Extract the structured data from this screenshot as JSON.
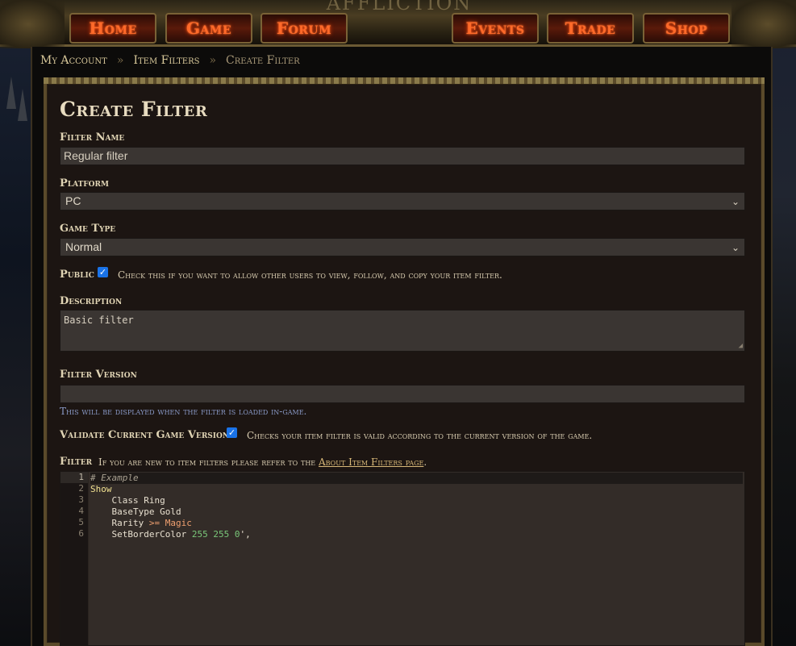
{
  "nav": {
    "logo": "AFFLICTION",
    "items": [
      "Home",
      "Game",
      "Forum",
      "Events",
      "Trade",
      "Shop"
    ]
  },
  "breadcrumb": {
    "items": [
      "My Account",
      "Item Filters",
      "Create Filter"
    ],
    "sep": "»"
  },
  "page": {
    "title": "Create Filter"
  },
  "form": {
    "filter_name": {
      "label": "Filter Name",
      "value": "Regular filter"
    },
    "platform": {
      "label": "Platform",
      "value": "PC"
    },
    "game_type": {
      "label": "Game Type",
      "value": "Normal"
    },
    "public": {
      "label": "Public",
      "checked": true,
      "hint": "Check this if you want to allow other users to view, follow, and copy your item filter."
    },
    "description": {
      "label": "Description",
      "value": "Basic filter"
    },
    "filter_version": {
      "label": "Filter Version",
      "value": "",
      "hint": "This will be displayed when the filter is loaded in-game."
    },
    "validate": {
      "label": "Validate Current Game Version",
      "checked": true,
      "hint": "Checks your item filter is valid according to the current version of the game."
    },
    "filter": {
      "label": "Filter",
      "hint_prefix": "If you are new to item filters please refer to the",
      "hint_link": "About Item Filters page",
      "hint_suffix": "."
    }
  },
  "editor": {
    "line_numbers": [
      "1",
      "2",
      "3",
      "4",
      "5",
      "6"
    ],
    "lines": {
      "l1": "# Example",
      "l2": "Show",
      "l3": "    Class Ring",
      "l4": "    BaseType Gold",
      "l5a": "    Rarity ",
      "l5b": ">=",
      "l5c": " Magic",
      "l6a": "    SetBorderColor ",
      "l6b": "255 255 0",
      "l6c": "',"
    }
  },
  "colors": {
    "nav_text": "#ff6a2a",
    "accent_gold": "#7a6a3a",
    "checkbox": "#1a73e8"
  },
  "icons": {
    "select_chevron": "chevron-down-icon",
    "check": "checkmark-icon"
  }
}
